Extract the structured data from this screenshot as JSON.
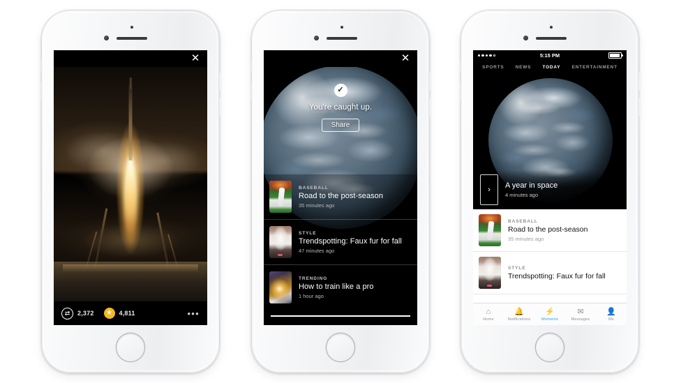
{
  "scene": {
    "description": "Three white iPhones showing Twitter Moments app screens",
    "background_color": "#ffffff",
    "device_color": "#f2f3f5"
  },
  "phone1": {
    "name": "moment-detail-screen",
    "close_icon": "✕",
    "photo_alt": "Soyuz rocket launching at night",
    "actions": {
      "retweet_icon": "⇄",
      "retweet_count": "2,372",
      "star_icon": "★",
      "star_count": "4,811",
      "more_icon": "•••"
    }
  },
  "phone2": {
    "name": "caught-up-screen",
    "close_icon": "✕",
    "check_icon": "✓",
    "caught_up_text": "You're caught up.",
    "share_label": "Share",
    "photo_alt": "Earth from space",
    "list": [
      {
        "kicker": "BASEBALL",
        "headline": "Road to the post-season",
        "time": "35 minutes ago",
        "thumb": "th-baseball"
      },
      {
        "kicker": "STYLE",
        "headline": "Trendspotting: Faux fur for fall",
        "time": "47 minutes ago",
        "thumb": "th-style"
      },
      {
        "kicker": "TRENDING",
        "headline": "How to train like a pro",
        "time": "1 hour ago",
        "thumb": "th-trend"
      }
    ]
  },
  "phone3": {
    "name": "moments-today-screen",
    "status_bar": {
      "time": "5:15 PM",
      "signal": "4 of 5 bars",
      "battery": "80%"
    },
    "tabs": [
      {
        "label": "SPORTS",
        "active": false
      },
      {
        "label": "NEWS",
        "active": false
      },
      {
        "label": "TODAY",
        "active": true
      },
      {
        "label": "ENTERTAINMENT",
        "active": false
      }
    ],
    "hero": {
      "arrow_icon": "›",
      "headline": "A year in space",
      "time": "4 minutes ago",
      "photo_alt": "Earth from space"
    },
    "list": [
      {
        "kicker": "BASEBALL",
        "headline": "Road to the post-season",
        "time": "35 minutes ago",
        "thumb": "th-baseball"
      },
      {
        "kicker": "STYLE",
        "headline": "Trendspotting: Faux fur for fall",
        "time": "",
        "thumb": "th-style"
      }
    ],
    "tabbar": [
      {
        "label": "Home",
        "icon": "⌂",
        "active": false
      },
      {
        "label": "Notifications",
        "icon": "🔔",
        "active": false
      },
      {
        "label": "Moments",
        "icon": "⚡",
        "active": true
      },
      {
        "label": "Messages",
        "icon": "✉",
        "active": false
      },
      {
        "label": "Me",
        "icon": "👤",
        "active": false
      }
    ],
    "accent_color": "#2aa3ef"
  }
}
